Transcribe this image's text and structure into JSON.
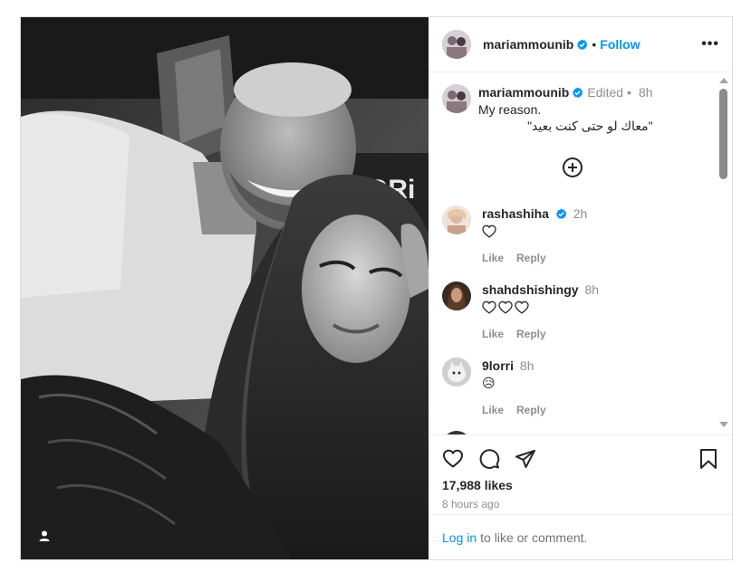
{
  "post": {
    "author": "mariammounib",
    "follow_label": "Follow",
    "separator": "•",
    "more_label": "•••",
    "caption": {
      "username": "mariammounib",
      "edited": "Edited",
      "separator": "•",
      "time": "8h",
      "line1": "My reason.",
      "line2": "\"معاك لو حتى كنت بعيد\""
    },
    "comments": [
      {
        "username": "rashashiha",
        "verified": true,
        "time": "2h",
        "text_icons": [
          "heart-outline"
        ],
        "like": "Like",
        "reply": "Reply"
      },
      {
        "username": "shahdshishingy",
        "verified": false,
        "time": "8h",
        "text_icons": [
          "heart-outline",
          "heart-outline",
          "heart-outline"
        ],
        "like": "Like",
        "reply": "Reply"
      },
      {
        "username": "9lorri",
        "verified": false,
        "time": "8h",
        "text_emoji": "😥",
        "like": "Like",
        "reply": "Reply"
      }
    ],
    "likes": "17,988 likes",
    "time_ago": "8 hours ago",
    "login": {
      "link": "Log in",
      "text": "to like or comment."
    }
  },
  "colors": {
    "accent": "#0095f6",
    "muted": "#8e8e8e",
    "text": "#262626",
    "border": "#dbdbdb"
  },
  "icons": [
    "verified-badge-icon",
    "more-options-icon",
    "add-circle-icon",
    "heart-icon",
    "comment-icon",
    "share-icon",
    "bookmark-icon",
    "user-tag-icon"
  ]
}
